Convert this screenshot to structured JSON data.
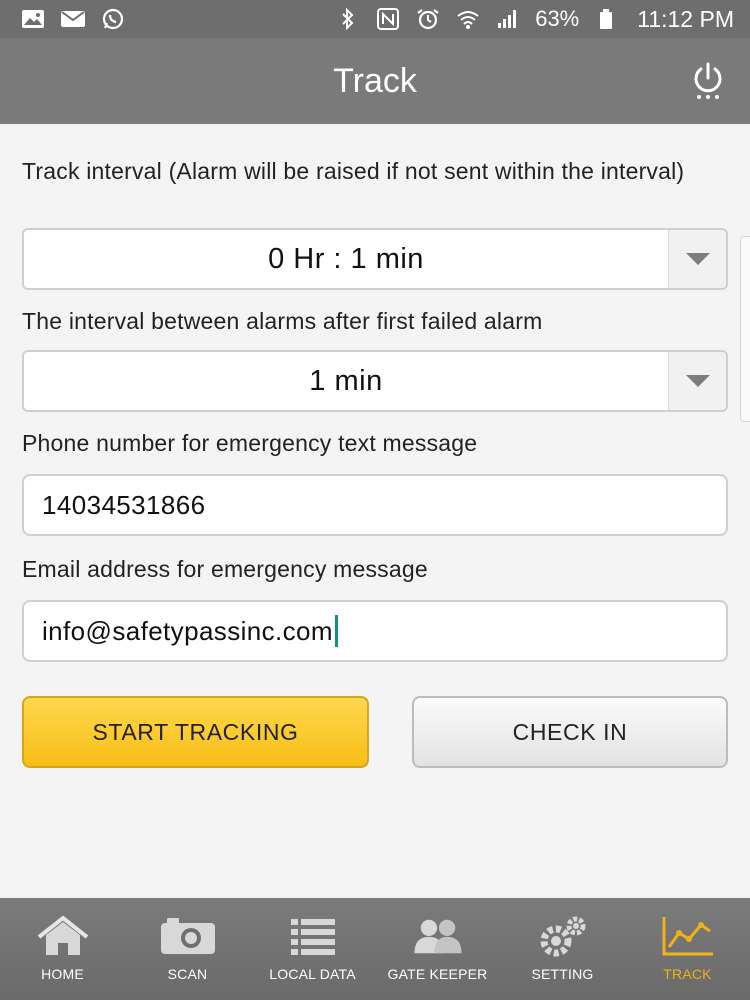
{
  "status_bar": {
    "icons_left": [
      "image-icon",
      "mail-icon",
      "whatsapp-icon"
    ],
    "icons_right": [
      "bluetooth-icon",
      "nfc-icon",
      "alarm-icon",
      "wifi-icon",
      "signal-icon",
      "battery-icon"
    ],
    "battery": "63%",
    "time": "11:12 PM"
  },
  "header": {
    "title": "Track",
    "power_icon": "power-icon"
  },
  "form": {
    "track_interval_label": "Track interval (Alarm will be raised if not sent within the interval)",
    "track_interval_value": "0 Hr : 1 min",
    "alarm_interval_label": "The interval between alarms after first failed alarm",
    "alarm_interval_value": "1 min",
    "phone_label": "Phone number for emergency text message",
    "phone_value": "14034531866",
    "email_label": "Email address for emergency message",
    "email_value": "info@safetypassinc.com"
  },
  "buttons": {
    "start_tracking": "START TRACKING",
    "check_in": "CHECK IN"
  },
  "nav": [
    {
      "label": "HOME",
      "icon": "home-icon",
      "active": false
    },
    {
      "label": "SCAN",
      "icon": "camera-icon",
      "active": false
    },
    {
      "label": "LOCAL DATA",
      "icon": "list-icon",
      "active": false
    },
    {
      "label": "GATE KEEPER",
      "icon": "users-icon",
      "active": false
    },
    {
      "label": "SETTING",
      "icon": "gears-icon",
      "active": false
    },
    {
      "label": "TRACK",
      "icon": "chart-icon",
      "active": true
    }
  ],
  "colors": {
    "accent": "#f7be16",
    "active_nav": "#f0b21a",
    "header_bg": "#7a7a7a",
    "caret": "#1a8c80"
  }
}
